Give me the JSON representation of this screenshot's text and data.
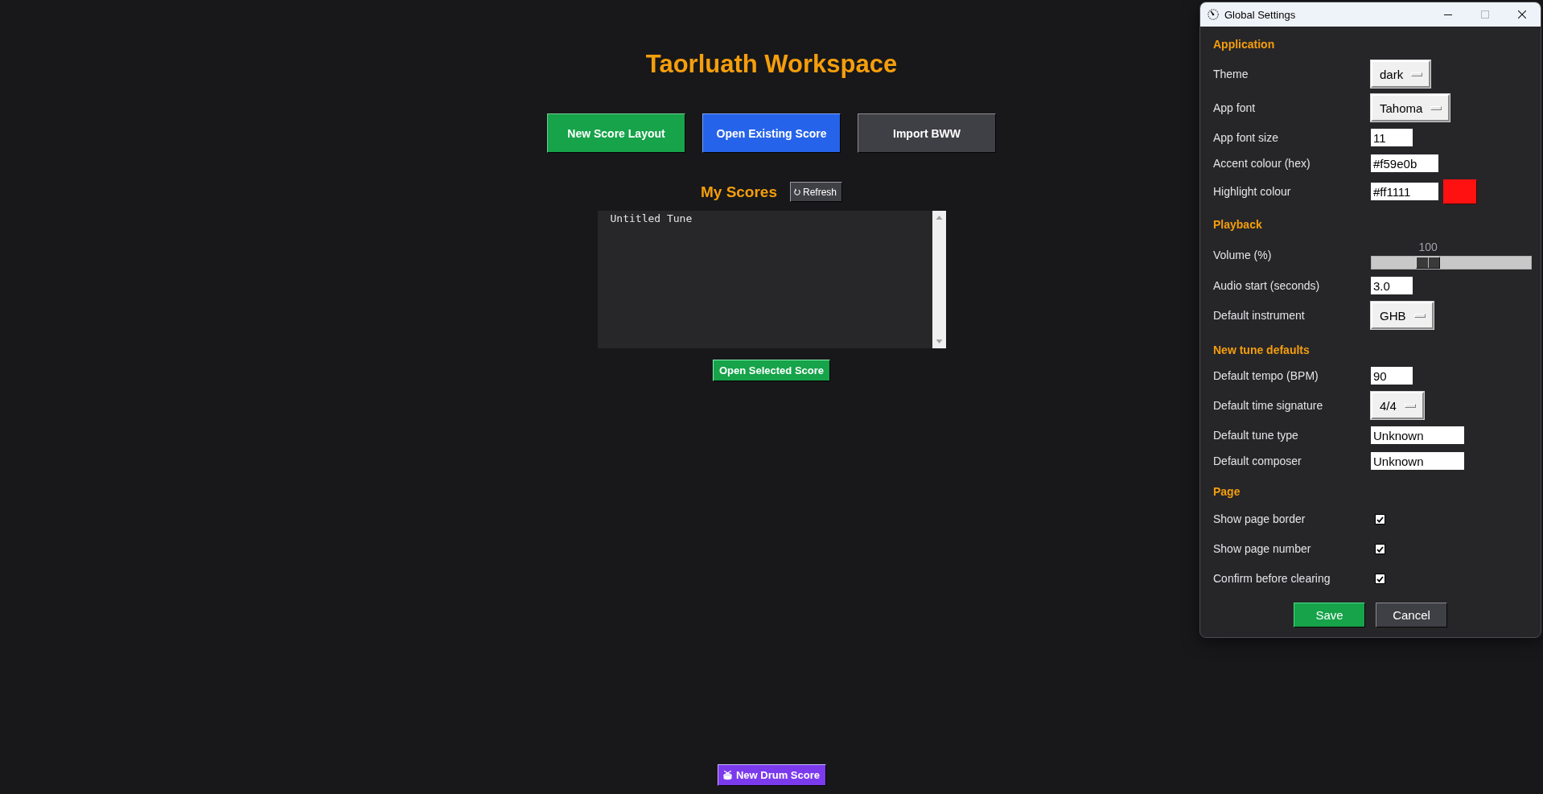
{
  "workspace": {
    "title": "Taorluath Workspace",
    "actions": [
      {
        "label": "New Score Layout",
        "color": "#16a34a"
      },
      {
        "label": "Open Existing Score",
        "color": "#2563eb"
      },
      {
        "label": "Import BWW",
        "color": "#3f3f46"
      }
    ],
    "scores": {
      "title": "My Scores",
      "refresh_button": "Refresh",
      "items": [
        {
          "name": "Untitled Tune",
          "selected": false
        }
      ],
      "open_button": "Open Selected Score"
    },
    "drum_button": "New Drum Score"
  },
  "settings_window": {
    "title": "Global Settings",
    "window_controls": [
      {
        "kind": "minimize",
        "disabled": false
      },
      {
        "kind": "maximize",
        "disabled": true
      },
      {
        "kind": "close",
        "disabled": false
      }
    ],
    "sections": [
      {
        "title": "Application",
        "rows": [
          {
            "kind": "dropdown",
            "label": "Theme",
            "value": "dark"
          },
          {
            "kind": "dropdown",
            "label": "App font",
            "value": "Tahoma"
          },
          {
            "kind": "number_entry",
            "label": "App font size",
            "value": "11"
          },
          {
            "kind": "hex_entry",
            "label": "Accent colour (hex)",
            "value": "#f59e0b"
          },
          {
            "kind": "color_entry",
            "label": "Highlight colour",
            "value": "#ff1111",
            "color": "#ff1111"
          }
        ]
      },
      {
        "title": "Playback",
        "rows": [
          {
            "kind": "slider",
            "label": "Volume (%)",
            "reading": "100",
            "level": 0.33
          },
          {
            "kind": "number_entry",
            "label": "Audio start (seconds)",
            "value": "3.0"
          },
          {
            "kind": "dropdown",
            "label": "Default instrument",
            "value": "GHB"
          }
        ]
      },
      {
        "title": "New tune defaults",
        "rows": [
          {
            "kind": "number_entry",
            "label": "Default tempo (BPM)",
            "value": "90"
          },
          {
            "kind": "dropdown",
            "label": "Default time signature",
            "value": "4/4"
          },
          {
            "kind": "text_entry",
            "label": "Default tune type",
            "value": "Unknown"
          },
          {
            "kind": "text_entry",
            "label": "Default composer",
            "value": "Unknown"
          }
        ]
      },
      {
        "title": "Page",
        "rows": [
          {
            "kind": "checkbox",
            "label": "Show page border",
            "checked": true
          },
          {
            "kind": "checkbox",
            "label": "Show page number",
            "checked": true
          },
          {
            "kind": "checkbox",
            "label": "Confirm before clearing",
            "checked": true
          }
        ]
      }
    ],
    "buttons": [
      {
        "label": "Save",
        "kind": "primary"
      },
      {
        "label": "Cancel",
        "kind": "secondary"
      }
    ]
  }
}
